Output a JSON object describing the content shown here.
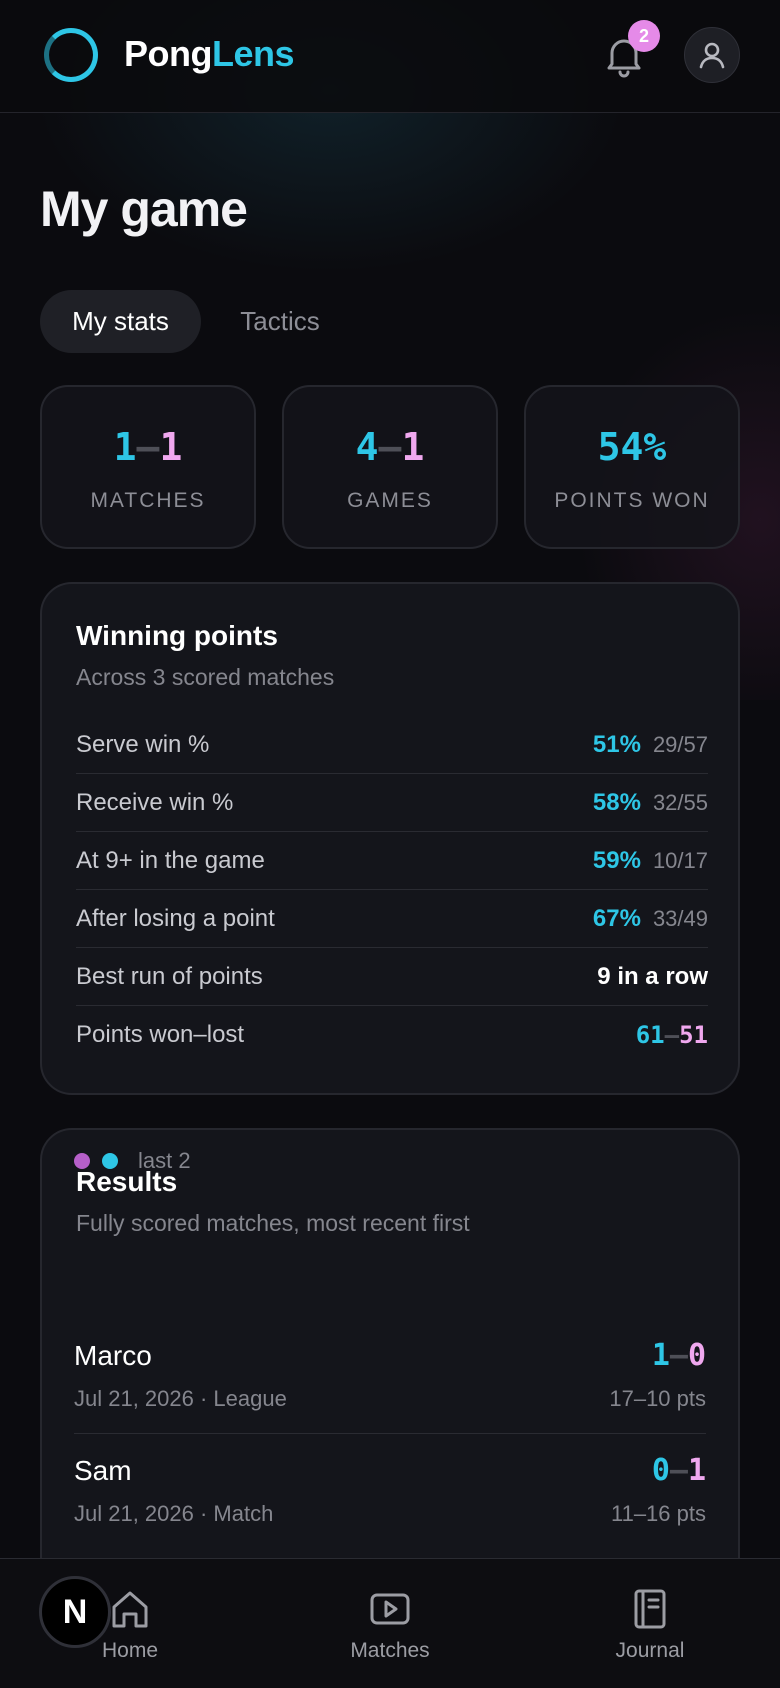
{
  "header": {
    "brand_part1": "Pong",
    "brand_part2": "Lens",
    "notification_count": "2",
    "icons": {
      "logo": "ring-logo-icon",
      "notifications": "bell-icon",
      "profile": "user-icon"
    }
  },
  "page": {
    "title": "My game",
    "tabs": [
      {
        "label": "My stats",
        "active": true
      },
      {
        "label": "Tactics",
        "active": false
      }
    ]
  },
  "stats": [
    {
      "win": "1",
      "sep": "–",
      "loss": "1",
      "label": "MATCHES"
    },
    {
      "win": "4",
      "sep": "–",
      "loss": "1",
      "label": "GAMES"
    },
    {
      "value": "54%",
      "label": "POINTS WON"
    }
  ],
  "winning_points": {
    "title": "Winning points",
    "subtitle": "Across 3 scored matches",
    "rows": [
      {
        "label": "Serve win %",
        "pct": "51%",
        "frac": "29/57"
      },
      {
        "label": "Receive win %",
        "pct": "58%",
        "frac": "32/55"
      },
      {
        "label": "At 9+ in the game",
        "pct": "59%",
        "frac": "10/17"
      },
      {
        "label": "After losing a point",
        "pct": "67%",
        "frac": "33/49"
      },
      {
        "label": "Best run of points",
        "value": "9 in a row"
      },
      {
        "label": "Points won–lost",
        "won": "61",
        "sep": "–",
        "lost": "51"
      }
    ]
  },
  "results": {
    "title": "Results",
    "subtitle": "Fully scored matches, most recent first",
    "legend_text": "last 2",
    "form_colors": [
      "#b65fc9",
      "#2ec6e6"
    ],
    "matches": [
      {
        "opponent": "Marco",
        "meta": "Jul 21, 2026 · League",
        "mine": "1",
        "sep": "–",
        "theirs": "0",
        "points": "17–10 pts"
      },
      {
        "opponent": "Sam",
        "meta": "Jul 21, 2026 · Match",
        "mine": "0",
        "sep": "–",
        "theirs": "1",
        "points": "11–16 pts"
      }
    ]
  },
  "nav": {
    "items": [
      {
        "label": "Home",
        "icon": "home-icon"
      },
      {
        "label": "Matches",
        "icon": "play-icon"
      },
      {
        "label": "Journal",
        "icon": "journal-icon"
      }
    ],
    "fab_letter": "N"
  },
  "colors": {
    "accent_cyan": "#2ec6e6",
    "accent_pink": "#f0a8ef",
    "background": "#0b0b0f"
  }
}
